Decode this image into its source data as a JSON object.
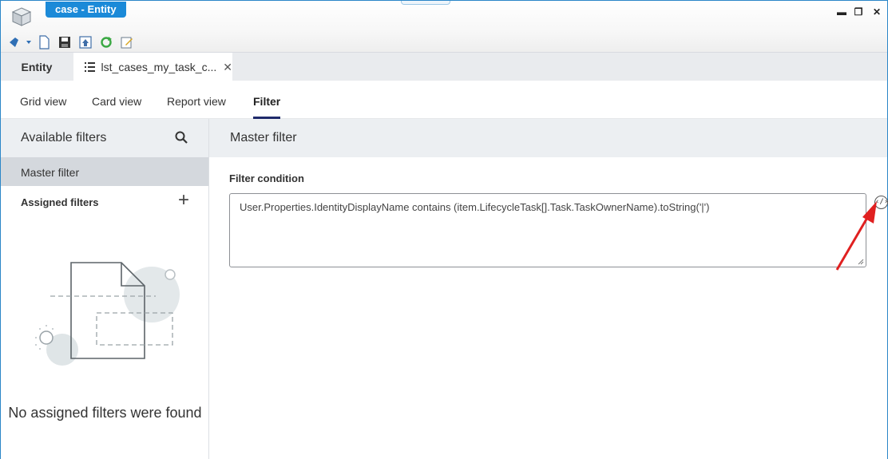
{
  "window": {
    "title": "case - Entity",
    "buttons": {
      "minimize": "▬",
      "restore": "❐",
      "close": "✕"
    }
  },
  "toolbar": {
    "icons": [
      "app-menu-icon",
      "new-document-icon",
      "save-icon",
      "publish-icon",
      "refresh-icon",
      "edit-icon"
    ]
  },
  "doc_tabs": {
    "entity_label": "Entity",
    "active_label": "lst_cases_my_task_c...",
    "close_glyph": "✕"
  },
  "view_tabs": [
    {
      "label": "Grid view"
    },
    {
      "label": "Card view"
    },
    {
      "label": "Report view"
    },
    {
      "label": "Filter",
      "active": true
    }
  ],
  "left_panel": {
    "title": "Available filters",
    "master_item": "Master filter",
    "assigned_label": "Assigned filters",
    "plus_glyph": "+",
    "empty_message": "No assigned filters were found"
  },
  "right_panel": {
    "title": "Master filter",
    "condition_label": "Filter condition",
    "condition_value": "User.Properties.IdentityDisplayName contains (item.LifecycleTask[].Task.TaskOwnerName).toString('|')",
    "code_button_glyph": "‹/›"
  },
  "colors": {
    "accent": "#1b8ad8",
    "active_tab_underline": "#1f2a6b",
    "annotation_arrow": "#e02020"
  }
}
